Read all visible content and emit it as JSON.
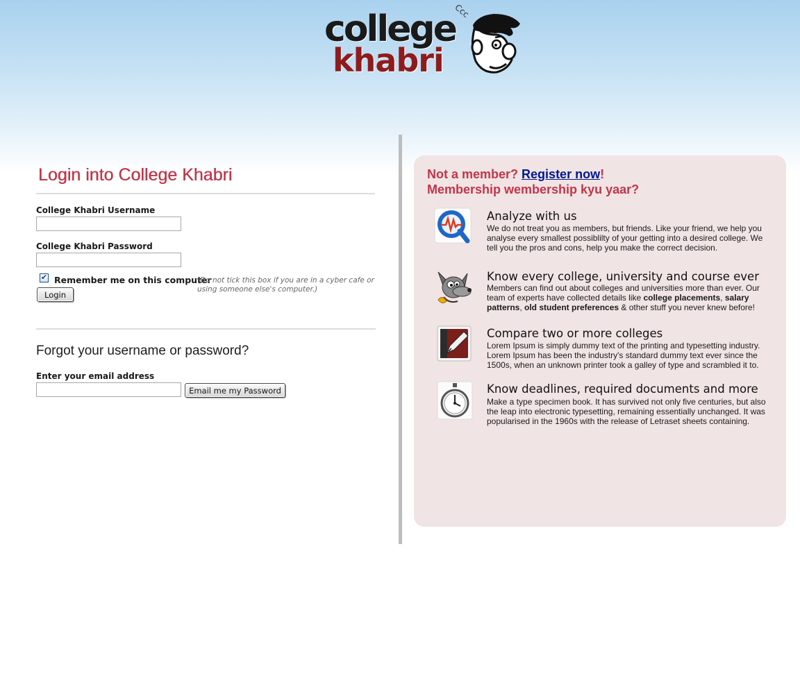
{
  "logo": {
    "line1": "college",
    "line2": "khabri",
    "sound": "Ccc"
  },
  "login": {
    "title": "Login into College Khabri",
    "username_label": "College Khabri Username",
    "username_value": "",
    "password_label": "College Khabri Password",
    "password_value": "",
    "remember_label": "Remember me on this computer",
    "remember_checked": true,
    "remember_note": "(Do not tick this box if you are in a cyber cafe or using someone else's computer.)",
    "login_button": "Login"
  },
  "forgot": {
    "title": "Forgot your username or password?",
    "email_label": "Enter your email address",
    "email_value": "",
    "submit_button": "Email me my Password"
  },
  "membership": {
    "line1_prefix": "Not a member?",
    "register_link": "Register now",
    "line1_suffix": "!",
    "line2": "Membership wembership kyu yaar?"
  },
  "features": [
    {
      "icon": "analyze-icon",
      "title": "Analyze with us",
      "desc": "We do not treat you as members, but friends. Like your friend, we help you analyse every smallest possiblilty of your getting into a desired college. We tell you the pros and cons, help you make the correct decision."
    },
    {
      "icon": "mascot-icon",
      "title": "Know every college, university and course ever",
      "desc_parts": {
        "a": "Members can find out about colleges and universities more than ever. Our team of experts have collected details like ",
        "b": "college placements",
        "c": ", ",
        "d": "salary patterns",
        "e": ", ",
        "f": "old student preferences",
        "g": " & other stuff you never knew before!"
      }
    },
    {
      "icon": "pen-nib-icon",
      "title": "Compare two or more colleges",
      "desc": "Lorem Ipsum is simply dummy text of the printing and typesetting industry. Lorem Ipsum has been the industry's standard dummy text ever since the 1500s, when an unknown printer took a galley of type and scrambled it to."
    },
    {
      "icon": "stopwatch-icon",
      "title": "Know deadlines, required documents and more",
      "desc": "Make a type specimen book. It has survived not only five centuries, but also the leap into electronic typesetting, remaining essentially unchanged. It was popularised in the 1960s with the release of Letraset sheets containing."
    }
  ],
  "colors": {
    "accent_red": "#c0364a",
    "panel_bg": "#f1e4e4",
    "link_blue": "#00178f",
    "sky_top": "#a9d1ee"
  }
}
